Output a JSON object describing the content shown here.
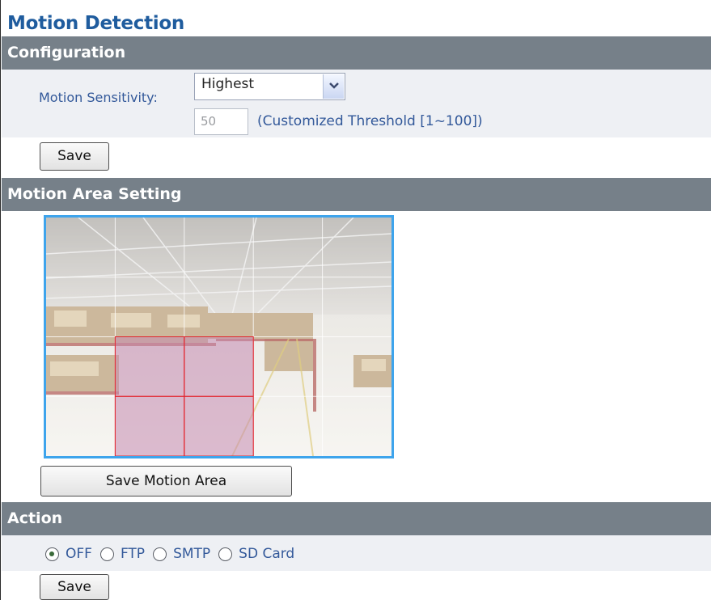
{
  "page": {
    "title": "Motion Detection"
  },
  "configuration": {
    "header": "Configuration",
    "sensitivity_label": "Motion Sensitivity:",
    "sensitivity_value": "Highest",
    "threshold_value": "50",
    "threshold_hint": "(Customized Threshold [1~100])",
    "save_label": "Save"
  },
  "motion_area": {
    "header": "Motion Area Setting",
    "grid": {
      "columns": 5,
      "rows": 4
    },
    "selected_cells": [
      [
        1,
        2
      ],
      [
        2,
        2
      ],
      [
        1,
        3
      ],
      [
        2,
        3
      ]
    ],
    "selection_color": "#c58bb0",
    "grid_line_color": "#ffffff",
    "selected_border_color": "#e0242e",
    "save_area_label": "Save Motion Area"
  },
  "action": {
    "header": "Action",
    "options": [
      {
        "label": "OFF",
        "checked": true
      },
      {
        "label": "FTP",
        "checked": false
      },
      {
        "label": "SMTP",
        "checked": false
      },
      {
        "label": "SD Card",
        "checked": false
      }
    ],
    "save_label": "Save"
  },
  "colors": {
    "section_header": "#768089",
    "title": "#1f5c9e",
    "label_text": "#33599a",
    "camera_border": "#3ea4ec"
  }
}
